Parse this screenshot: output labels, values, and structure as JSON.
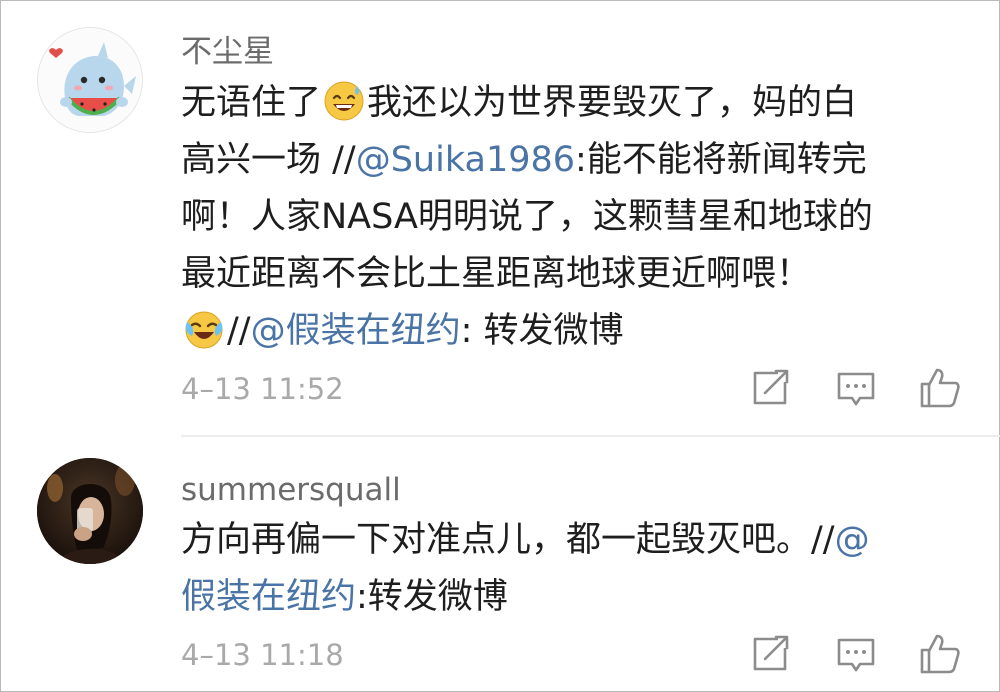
{
  "comments": [
    {
      "username": "不尘星",
      "line1_a": "无语住了",
      "line1_b": "我还以为世界要毁灭了，妈的白",
      "line2_a": "高兴一场 //",
      "line2_mention": "@Suika1986",
      "line2_b": ":能不能将新闻转完",
      "line3": "啊！人家NASA明明说了，这颗彗星和地球的",
      "line4": "最近距离不会比土星距离地球更近啊喂！",
      "line5_a": "//",
      "line5_mention": "@假装在纽约",
      "line5_b": ": 转发微博",
      "emoji1": "sweat-smile-emoji",
      "emoji2": "laughing-tears-emoji",
      "time": "4–13 11:52"
    },
    {
      "username": "summersquall",
      "line1_a": "方向再偏一下对准点儿，都一起毁灭吧。//",
      "line1_mention": "@",
      "line2_mention": "假装在纽约",
      "line2_b": ":转发微博",
      "time": "4–13 11:18"
    }
  ],
  "icons": {
    "repost": "repost-icon",
    "comment": "comment-icon",
    "like": "like-icon"
  },
  "colors": {
    "mention": "#4a74a6",
    "username": "#6b6b6b",
    "timestamp": "#a9a9a9",
    "icon": "#8c8c8c"
  }
}
